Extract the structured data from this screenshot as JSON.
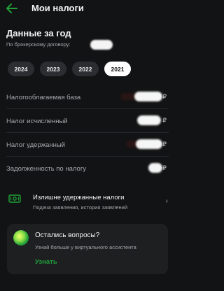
{
  "header": {
    "title": "Мои налоги",
    "back_icon": "arrow-left-icon"
  },
  "summary": {
    "title": "Данные за год",
    "contract_label": "По брокерскому договору:"
  },
  "years": {
    "items": [
      "2024",
      "2023",
      "2022",
      "2021"
    ],
    "selected": "2021"
  },
  "rows": [
    {
      "label": "Налогооблагаемая база",
      "currency": "₽"
    },
    {
      "label": "Налог исчисленный",
      "currency": "₽"
    },
    {
      "label": "Налог удержанный",
      "currency": "₽"
    },
    {
      "label": "Задолженность по налогу",
      "currency": "₽"
    }
  ],
  "refund": {
    "title": "Излишне удержанные налоги",
    "subtitle": "Подача заявления, история заявлений",
    "icon": "banknote-icon"
  },
  "assistant": {
    "title": "Остались вопросы?",
    "subtitle": "Узнай больше у виртуального ассистента",
    "link": "Узнать"
  },
  "colors": {
    "background": "#121314",
    "accent": "#21a038",
    "card": "#1d1f21"
  }
}
